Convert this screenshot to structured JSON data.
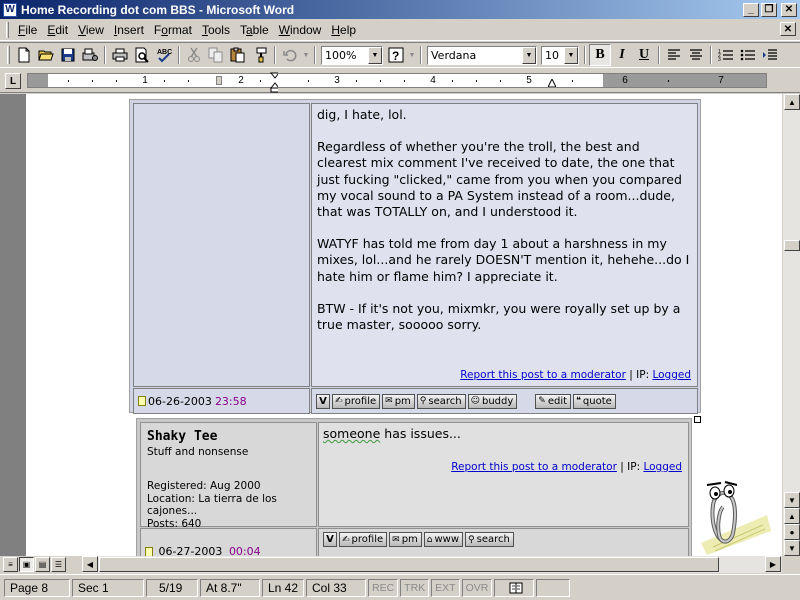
{
  "window": {
    "app_icon": "W",
    "title": "Home Recording dot com BBS - Microsoft Word",
    "minimize_glyph": "_",
    "restore_glyph": "❐",
    "close_glyph": "✕"
  },
  "menu": [
    {
      "key": "F",
      "rest": "ile"
    },
    {
      "key": "E",
      "rest": "dit"
    },
    {
      "key": "V",
      "rest": "iew"
    },
    {
      "key": "I",
      "rest": "nsert"
    },
    {
      "pre": "F",
      "key": "o",
      "rest": "rmat"
    },
    {
      "key": "T",
      "rest": "ools"
    },
    {
      "pre": "T",
      "key": "a",
      "rest": "ble"
    },
    {
      "key": "W",
      "rest": "indow"
    },
    {
      "key": "H",
      "rest": "elp"
    }
  ],
  "toolbar": {
    "zoom": "100%",
    "font": "Verdana",
    "size": "10",
    "bold": "B",
    "italic": "I",
    "underline": "U"
  },
  "ruler": {
    "corner": "L",
    "numbers": [
      "1",
      "2",
      "3",
      "4",
      "5",
      "6",
      "7"
    ]
  },
  "post1": {
    "paragraphs": [
      "dig, I hate, lol.",
      "Regardless of whether you're the troll, the best and clearest mix comment I've received to date, the one that just fucking \"clicked,\" came from you when you compared my vocal sound to a PA System instead of a room...dude, that was TOTALLY on, and I understood it.",
      "WATYF has told me from day 1 about a harshness in my mixes, lol...and he rarely DOESN'T mention it, hehehe...do I hate him or flame him? I appreciate it.",
      "BTW - If it's not you, mixmkr, you were royally set up by a true master, sooooo sorry."
    ],
    "report_link": "Report this post to a moderator",
    "ip_label": " | IP: ",
    "ip_value": "Logged",
    "date": "06-26-2003",
    "time": "23:58",
    "buttons": {
      "v": "V",
      "profile": "profile",
      "pm": "pm",
      "search": "search",
      "buddy": "buddy",
      "edit": "edit",
      "quote": "quote"
    }
  },
  "post2": {
    "username": "Shaky Tee",
    "user_title": "Stuff and nonsense",
    "registered": "Registered: Aug 2000",
    "location": "Location: La tierra de los cajones...",
    "posts": "Posts: 640",
    "body_word": "someone",
    "body_rest": " has issues...",
    "report_link": "Report this post to a moderator",
    "ip_label": " | IP: ",
    "ip_value": "Logged",
    "date": "06-27-2003",
    "time": "00:04",
    "buttons": {
      "v": "V",
      "profile": "profile",
      "pm": "pm",
      "www": "www",
      "search": "search"
    }
  },
  "status": {
    "page": "Page 8",
    "sec": "Sec 1",
    "pages": "5/19",
    "at": "At 8.7\"",
    "ln": "Ln 42",
    "col": "Col 33",
    "rec": "REC",
    "trk": "TRK",
    "ext": "EXT",
    "ovr": "OVR"
  }
}
